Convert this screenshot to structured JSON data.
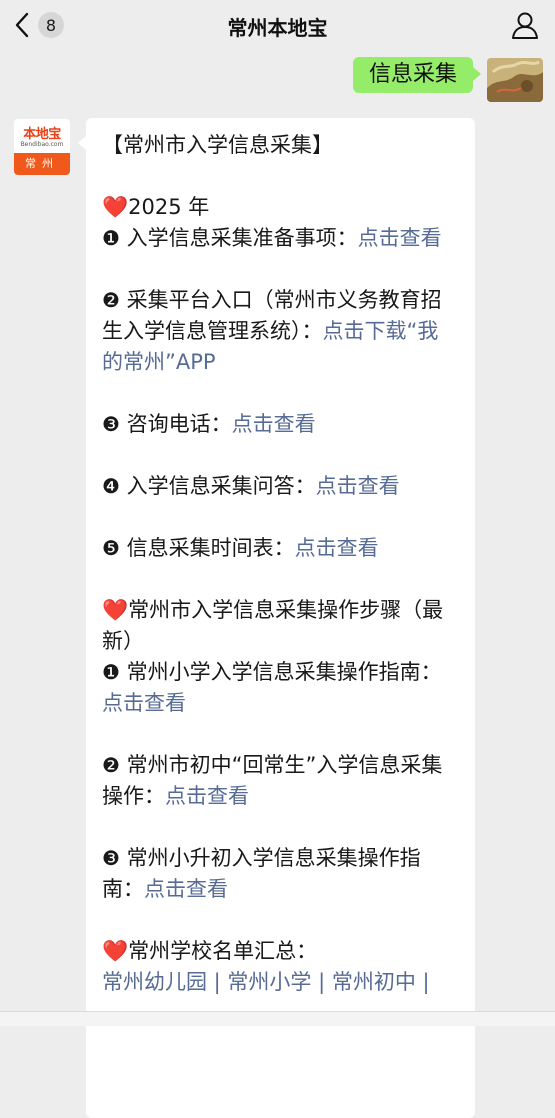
{
  "header": {
    "title": "常州本地宝",
    "unread_count": "8"
  },
  "outgoing": {
    "text": "信息采集"
  },
  "bot": {
    "logo_text": "本地宝",
    "logo_sub": "Bendibao.com",
    "city_label": "常州"
  },
  "message": {
    "heading": "【常州市入学信息采集】",
    "year": "2025 年",
    "items": [
      {
        "num": "❶",
        "text": " 入学信息采集准备事项：",
        "link": "点击查看"
      },
      {
        "num": "❷",
        "text": " 采集平台入口（常州市义务教育招生入学信息管理系统）：",
        "link": "点击下载“我的常州”APP"
      },
      {
        "num": "❸",
        "text": " 咨询电话：",
        "link": "点击查看"
      },
      {
        "num": "❹",
        "text": " 入学信息采集问答：",
        "link": "点击查看"
      },
      {
        "num": "❺",
        "text": " 信息采集时间表：",
        "link": "点击查看"
      }
    ],
    "steps_heading": "常州市入学信息采集操作步骤（最新）",
    "steps": [
      {
        "num": "❶",
        "text": " 常州小学入学信息采集操作指南：",
        "link": "点击查看"
      },
      {
        "num": "❷",
        "text": " 常州市初中“回常生”入学信息采集操作：",
        "link": "点击查看"
      },
      {
        "num": "❸",
        "text": " 常州小升初入学信息采集操作指南：",
        "link": "点击查看"
      }
    ],
    "schools_heading": "常州学校名单汇总：",
    "schools_links": "常州幼儿园 | 常州小学 | 常州初中 |"
  },
  "colors": {
    "link": "#576b95",
    "bubble_out": "#95ec69",
    "heart": "#e0213a"
  }
}
